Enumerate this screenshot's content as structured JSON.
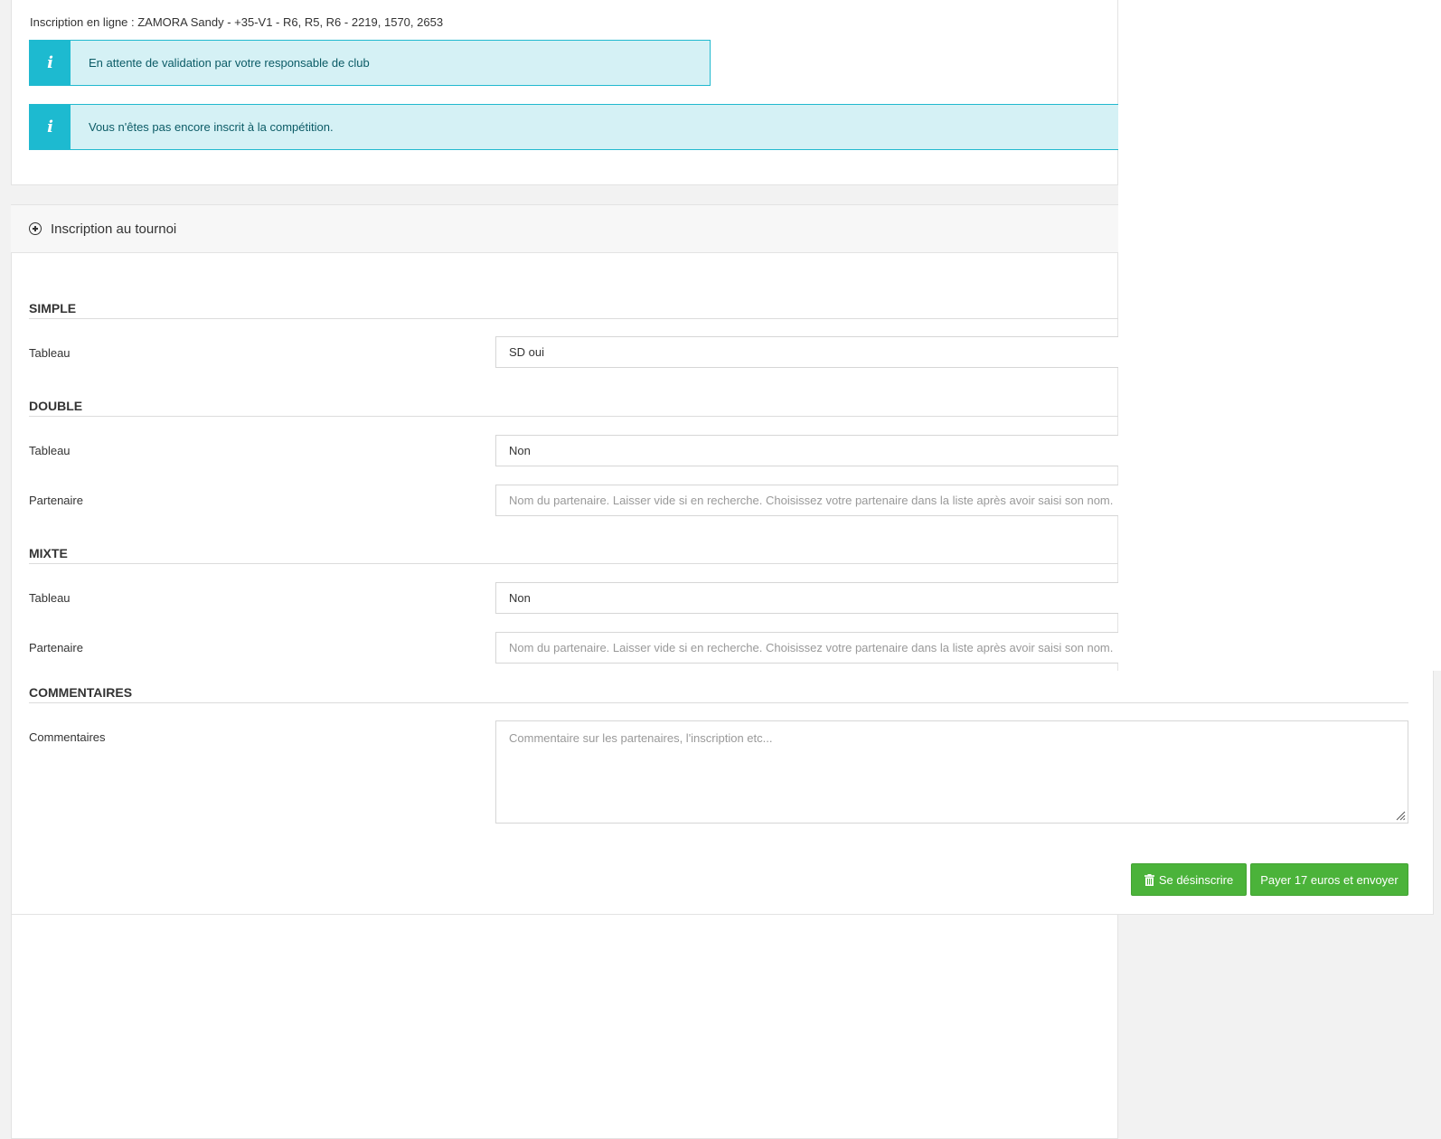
{
  "header": {
    "registration_line": "Inscription en ligne : ZAMORA Sandy - +35-V1 - R6, R5, R6 - 2219, 1570, 2653"
  },
  "alerts": [
    {
      "icon": "info-icon",
      "text": "En attente de validation par votre responsable de club"
    },
    {
      "icon": "info-icon",
      "text": "Vous n'êtes pas encore inscrit à la compétition."
    }
  ],
  "panel": {
    "icon": "plus-circle-icon",
    "title": "Inscription au tournoi"
  },
  "simple": {
    "heading": "SIMPLE",
    "tableau_label": "Tableau",
    "tableau_value": "SD oui"
  },
  "double": {
    "heading": "DOUBLE",
    "tableau_label": "Tableau",
    "tableau_value": "Non",
    "partner_label": "Partenaire",
    "partner_placeholder": "Nom du partenaire. Laisser vide si en recherche. Choisissez votre partenaire dans la liste après avoir saisi son nom."
  },
  "mixte": {
    "heading": "MIXTE",
    "tableau_label": "Tableau",
    "tableau_value": "Non",
    "partner_label": "Partenaire",
    "partner_placeholder": "Nom du partenaire. Laisser vide si en recherche. Choisissez votre partenaire dans la liste après avoir saisi son nom."
  },
  "comments": {
    "heading": "COMMENTAIRES",
    "label": "Commentaires",
    "placeholder": "Commentaire sur les partenaires, l'inscription etc..."
  },
  "actions": {
    "unsubscribe_label": "Se désinscrire",
    "pay_label": "Payer 17 euros et envoyer"
  },
  "colors": {
    "info_bg": "#d5f1f5",
    "info_accent": "#1dbad0",
    "button_green": "#4bb33a"
  }
}
